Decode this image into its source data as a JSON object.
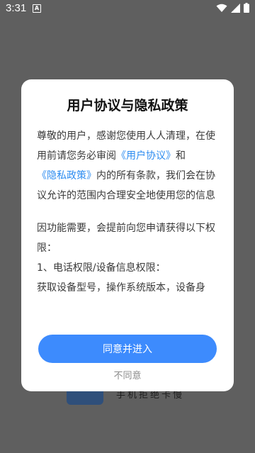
{
  "status_bar": {
    "time": "3:31",
    "notif_glyph": "A"
  },
  "background": {
    "app_text": "手机拒绝卡慢"
  },
  "dialog": {
    "title": "用户协议与隐私政策",
    "p1": {
      "text_a": "尊敬的用户，感谢您使用人人清理，在使用前请您务必审阅",
      "link_user_agreement": "《用户协议》",
      "text_b": "和",
      "link_privacy_policy": "《隐私政策》",
      "text_c": "内的所有条款，我们会在协议允许的范围内合理安全地使用您的信息"
    },
    "p2": {
      "intro": "因功能需要，会提前向您申请获得以下权限：",
      "item1_title": "1、电话权限/设备信息权限：",
      "item1_desc": "获取设备型号，操作系统版本，设备身"
    },
    "agree_label": "同意并进入",
    "disagree_label": "不同意"
  },
  "colors": {
    "accent": "#3d8bfd",
    "link": "#2d8cf0",
    "scrim": "#5f5f5f"
  }
}
